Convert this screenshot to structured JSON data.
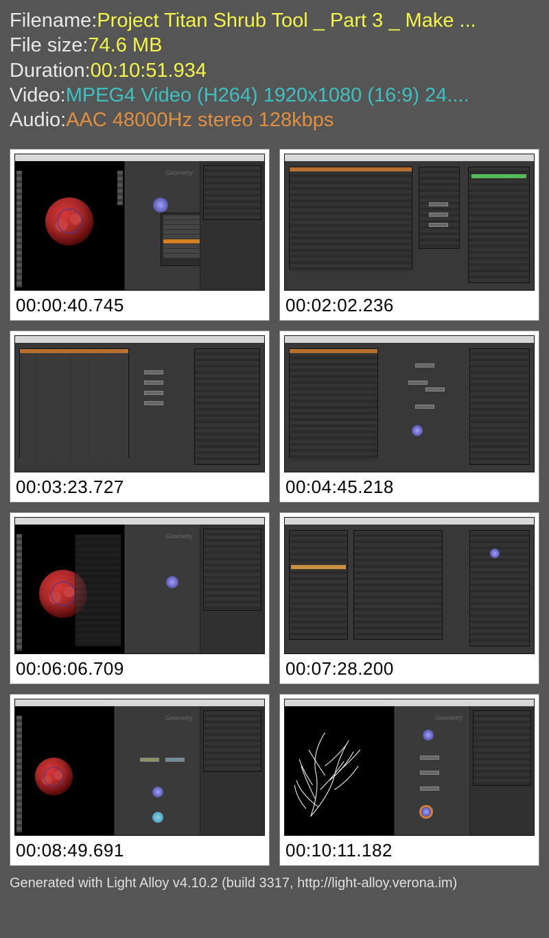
{
  "info": {
    "filename_label": "Filename: ",
    "filename_value": "Project Titan Shrub Tool _ Part 3 _ Make ...",
    "filesize_label": "File size: ",
    "filesize_value": "74.6 MB",
    "duration_label": "Duration: ",
    "duration_value": "00:10:51.934",
    "video_label": "Video: ",
    "video_value": "MPEG4 Video (H264) 1920x1080 (16:9) 24....",
    "audio_label": "Audio: ",
    "audio_value": "AAC 48000Hz stereo 128kbps"
  },
  "thumbs": [
    {
      "time": "00:00:40.745",
      "variant": "shrub_menu"
    },
    {
      "time": "00:02:02.236",
      "variant": "params_nodes"
    },
    {
      "time": "00:03:23.727",
      "variant": "params_table"
    },
    {
      "time": "00:04:45.218",
      "variant": "params_graph"
    },
    {
      "time": "00:06:06.709",
      "variant": "shrub_left"
    },
    {
      "time": "00:07:28.200",
      "variant": "params_dense"
    },
    {
      "time": "00:08:49.691",
      "variant": "shrub_nodes2"
    },
    {
      "time": "00:10:11.182",
      "variant": "branches_graph"
    }
  ],
  "footer": "Generated with Light Alloy v4.10.2 (build 3317, http://light-alloy.verona.im)"
}
